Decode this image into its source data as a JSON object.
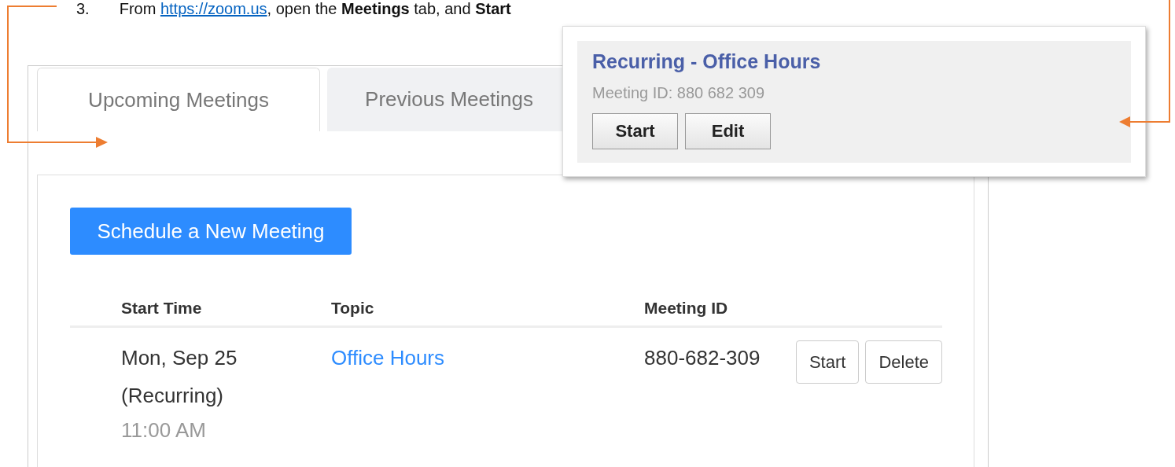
{
  "instruction": {
    "number": "3.",
    "prefix": "From ",
    "link": "https://zoom.us",
    "suffix": ", open the **Meetings** tab, and **Start**"
  },
  "tabs": [
    {
      "label": "Upcoming Meetings",
      "selected": true
    },
    {
      "label": "Previous Meetings",
      "selected": false
    }
  ],
  "schedule_button": "Schedule a New Meeting",
  "table": {
    "columns": [
      "Start Time",
      "Topic",
      "Meeting ID"
    ],
    "rows": [
      {
        "start_date": "Mon, Sep 25 (Recurring)",
        "start_time": "11:00 AM",
        "topic": "Office Hours",
        "meeting_id": "880-682-309",
        "actions": [
          "Start",
          "Delete"
        ]
      }
    ]
  },
  "popup": {
    "title": "Recurring - Office Hours",
    "subtitle": "Meeting ID: 880 682 309",
    "buttons": [
      "Start",
      "Edit"
    ]
  }
}
